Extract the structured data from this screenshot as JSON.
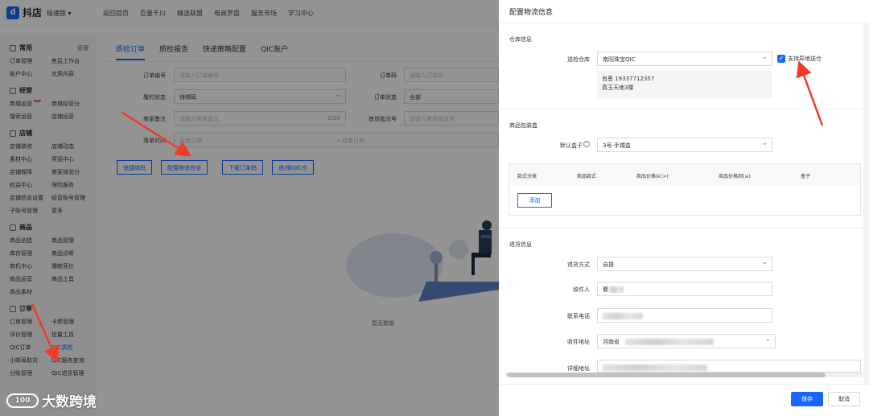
{
  "topbar": {
    "logo": "抖店",
    "edition": "极速版",
    "nav": [
      "返回首页",
      "巨量千川",
      "精选联盟",
      "电商罗盘",
      "服务市场",
      "学习中心"
    ]
  },
  "sidebar": {
    "sections": [
      {
        "title": "常用",
        "manage": "管理",
        "items": [
          "订单管理",
          "售后工作台",
          "账户中心",
          "优质内容"
        ]
      },
      {
        "title": "经营",
        "items": [
          "商城运营",
          "商城经营分",
          "搜索运营",
          "店铺运营"
        ],
        "badge": "新"
      },
      {
        "title": "店铺",
        "items": [
          "店铺装修",
          "店铺动态",
          "素材中心",
          "奖惩中心",
          "店铺保障",
          "商家体验分",
          "权益中心",
          "保险服务",
          "店铺信息设置",
          "经营账号管理",
          "子账号管理",
          "更多"
        ]
      },
      {
        "title": "商品",
        "items": [
          "商品创建",
          "商品管理",
          "库存管理",
          "商品诊断",
          "商机中心",
          "爆款竞价",
          "商品运营",
          "商品工具",
          "商品素材"
        ]
      },
      {
        "title": "订单",
        "items": [
          "订单管理",
          "卡券管理",
          "评价管理",
          "批量工具",
          "QIC订单",
          "QIC质检",
          "小邮局取货",
          "QIC服务查询",
          "分账管理",
          "QIC退货管理"
        ]
      }
    ]
  },
  "main": {
    "tabs": [
      "质检订单",
      "质检报告",
      "快递策略配置",
      "QIC账户"
    ],
    "filters": {
      "order_no_label": "订单编号",
      "order_no_ph": "请输入订单编号",
      "order_code_label": "订单码",
      "order_code_ph": "请输入订单码",
      "status_label": "履约状态",
      "status_val": "待绑码",
      "order_status_label": "订单状态",
      "order_status_val": "全部",
      "remark_label": "商家备注",
      "remark_ph": "请输入商家备注",
      "remark_count": "0/20",
      "batch_label": "拣货批次号",
      "batch_ph": "请输入拣货批次号",
      "time_label": "落单时间",
      "start_ph": "开始日期",
      "end_ph": "结束日期"
    },
    "buttons": [
      "快捷绑码",
      "配置物流信息",
      "下载订单码",
      "退/换QIC仓"
    ],
    "empty_text": "暂无数据"
  },
  "drawer": {
    "title": "配置物流信息",
    "warehouse": {
      "section": "仓库信息",
      "label": "送检仓库",
      "value": "南阳珠宝QIC",
      "checkbox": "支持异地送仓",
      "contact": "肖恩 19337712357",
      "address": "真玉天地3楼"
    },
    "box": {
      "section": "商品包装盒",
      "label": "默认盒子",
      "value": "3号-手镯盒",
      "cols": [
        "款式分类",
        "商品款式",
        "商品价格从(>)",
        "商品价格到(≤)",
        "盒子"
      ],
      "add": "添加"
    },
    "return": {
      "section": "退货信息",
      "method_label": "退货方式",
      "method_val": "自提",
      "receiver_label": "收件人",
      "receiver_val": "曹",
      "phone_label": "联系电话",
      "region_label": "收件地址",
      "region_val": "河南省",
      "detail_label": "详细地址"
    },
    "save": "保存",
    "cancel": "取消"
  },
  "watermark": {
    "text": "大数跨境",
    "logo": "100"
  }
}
